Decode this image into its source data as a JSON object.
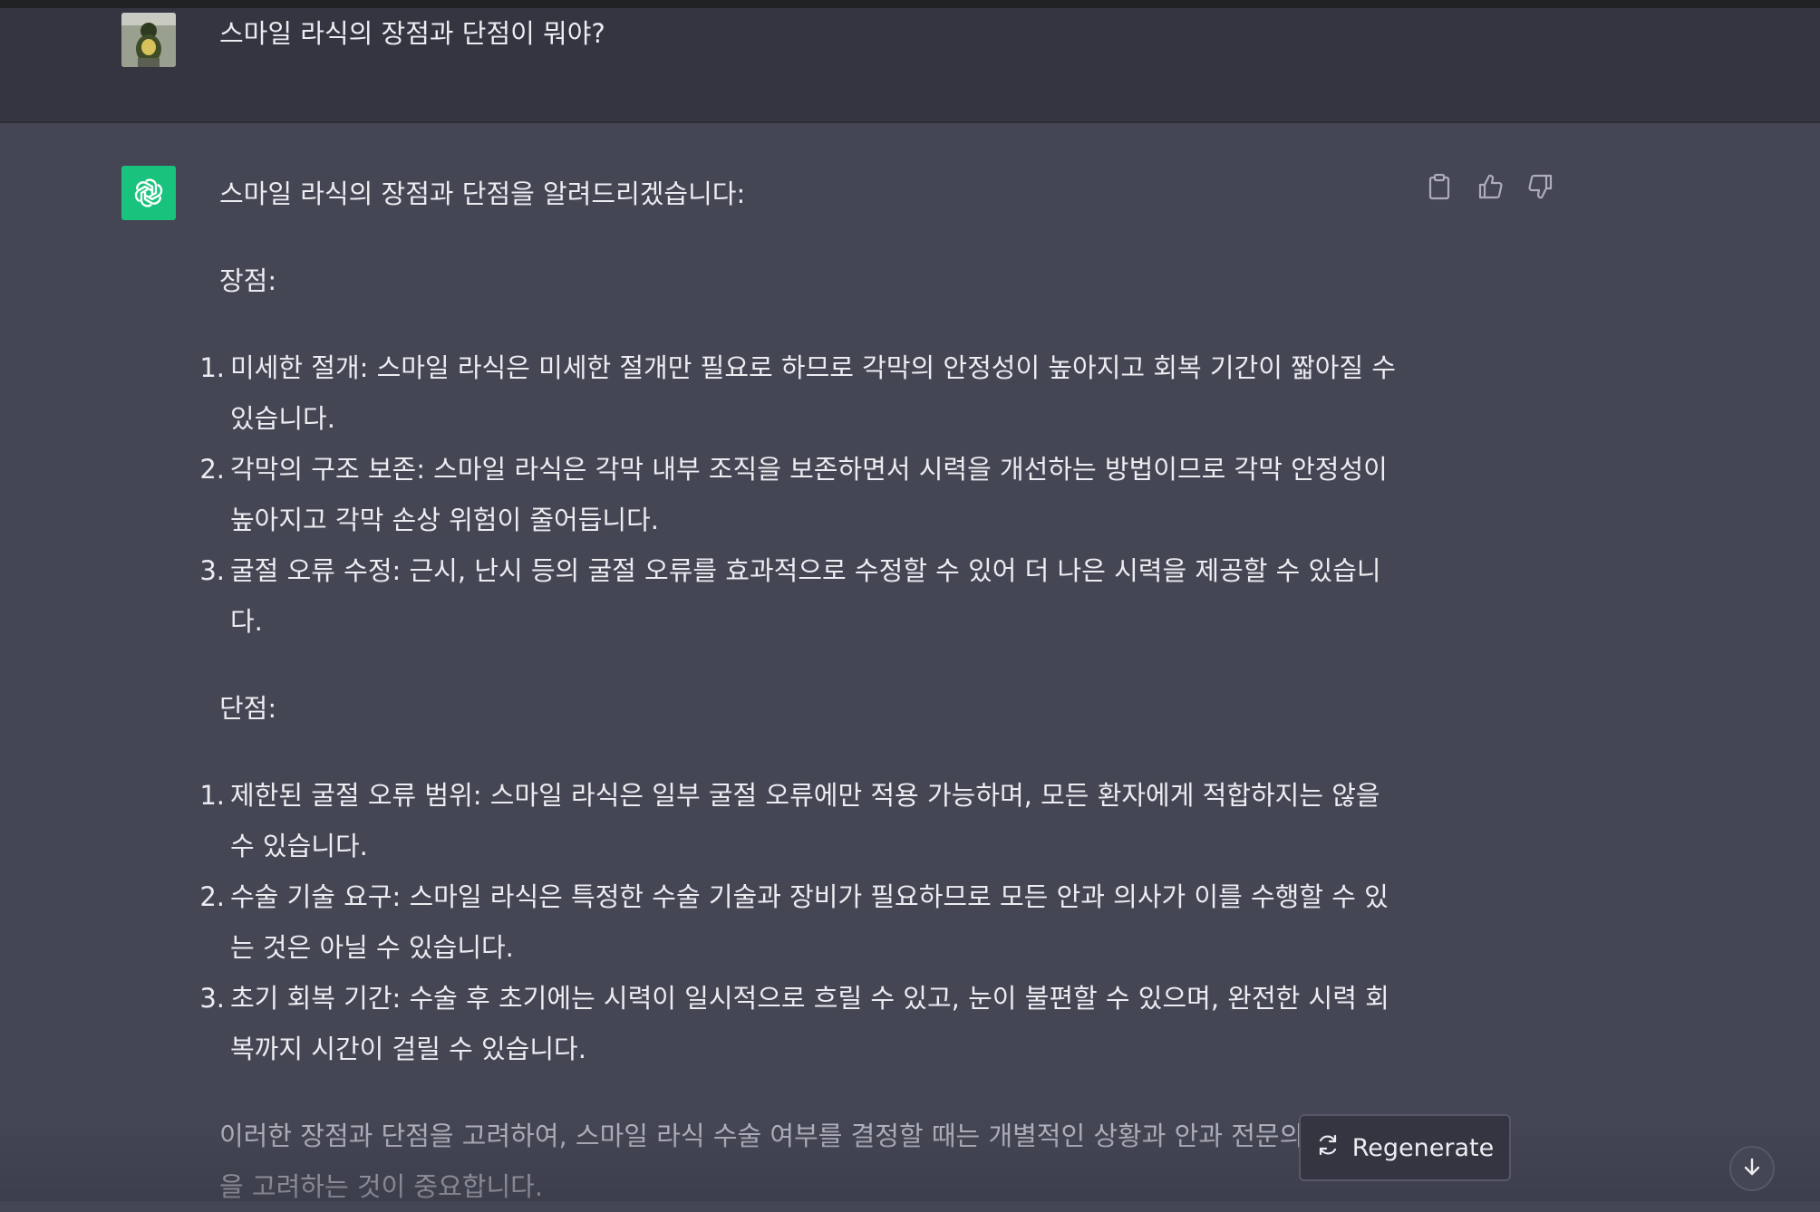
{
  "conversation": {
    "user_message": "스마일 라식의 장점과 단점이 뭐야?",
    "assistant": {
      "intro": "스마일 라식의 장점과 단점을 알려드리겠습니다:",
      "pros_heading": "장점:",
      "pros": [
        {
          "num": "1.",
          "line1": "미세한 절개: 스마일 라식은 미세한 절개만 필요로 하므로 각막의 안정성이 높아지고 회복 기간이 짧아질 수",
          "line2": "있습니다."
        },
        {
          "num": "2.",
          "line1": "각막의 구조 보존: 스마일 라식은 각막 내부 조직을 보존하면서 시력을 개선하는 방법이므로 각막 안정성이",
          "line2": "높아지고 각막 손상 위험이 줄어듭니다."
        },
        {
          "num": "3.",
          "line1": "굴절 오류 수정: 근시, 난시 등의 굴절 오류를 효과적으로 수정할 수 있어 더 나은 시력을 제공할 수 있습니",
          "line2": "다."
        }
      ],
      "cons_heading": "단점:",
      "cons": [
        {
          "num": "1.",
          "line1": "제한된 굴절 오류 범위: 스마일 라식은 일부 굴절 오류에만 적용 가능하며, 모든 환자에게 적합하지는 않을",
          "line2": "수 있습니다."
        },
        {
          "num": "2.",
          "line1": "수술 기술 요구: 스마일 라식은 특정한 수술 기술과 장비가 필요하므로 모든 안과 의사가 이를 수행할 수 있",
          "line2": "는 것은 아닐 수 있습니다."
        },
        {
          "num": "3.",
          "line1": "초기 회복 기간: 수술 후 초기에는 시력이 일시적으로 흐릴 수 있고, 눈이 불편할 수 있으며, 완전한 시력 회",
          "line2": "복까지 시간이 걸릴 수 있습니다."
        }
      ],
      "closing_line1": "이러한 장점과 단점을 고려하여, 스마일 라식 수술 여부를 결정할 때는 개별적인 상황과 안과 전문의",
      "closing_line2": "을 고려하는 것이 중요합니다."
    }
  },
  "actions": {
    "copy_icon": "clipboard-icon",
    "like_icon": "thumbs-up-icon",
    "dislike_icon": "thumbs-down-icon"
  },
  "regenerate": {
    "label": "Regenerate",
    "icon": "refresh-icon"
  },
  "scroll": {
    "icon": "arrow-down-icon"
  },
  "colors": {
    "background": "#444654",
    "user_row": "#343541",
    "gpt_avatar": "#19c37d",
    "text": "#ececf1"
  }
}
